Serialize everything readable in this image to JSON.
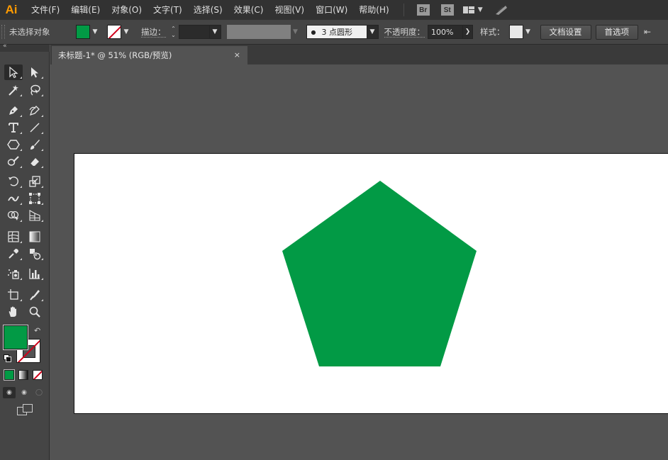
{
  "app": {
    "logo": "Ai"
  },
  "menu": [
    "文件(F)",
    "编辑(E)",
    "对象(O)",
    "文字(T)",
    "选择(S)",
    "效果(C)",
    "视图(V)",
    "窗口(W)",
    "帮助(H)"
  ],
  "bridge_badges": {
    "br": "Br",
    "st": "St"
  },
  "icons": {
    "workspace": "workspace-layout-icon",
    "dropdown": "chevron-down-icon",
    "sync": "sync-feather-icon"
  },
  "control_bar": {
    "selection_status": "未选择对象",
    "stroke_label": "描边：",
    "stroke_weight": "",
    "brush_definition": "3 点圆形",
    "opacity_label": "不透明度：",
    "opacity_value": "100%",
    "style_label": "样式：",
    "document_setup": "文档设置",
    "preferences": "首选项"
  },
  "document": {
    "tab_title": "未标题-1* @ 51% (RGB/预览)",
    "close_glyph": "×",
    "zoom_percent": 51,
    "color_mode": "RGB",
    "view": "预览"
  },
  "colors": {
    "fill": "#029a45",
    "stroke": "none",
    "artboard": "#ffffff",
    "pasteboard": "#535353",
    "accent_logo": "#ff9a00"
  },
  "artwork": {
    "shape": "pentagon",
    "fill_color": "#029a45"
  },
  "tools": [
    "selection-tool",
    "direct-selection-tool",
    "magic-wand-tool",
    "lasso-tool",
    "pen-tool",
    "curvature-tool",
    "type-tool",
    "line-segment-tool",
    "polygon-tool",
    "paintbrush-tool",
    "shaper-tool",
    "eraser-tool",
    "rotate-tool",
    "scale-tool",
    "width-tool",
    "free-transform-tool",
    "shape-builder-tool",
    "perspective-grid-tool",
    "mesh-tool",
    "gradient-tool",
    "eyedropper-tool",
    "blend-tool",
    "symbol-sprayer-tool",
    "column-graph-tool",
    "artboard-tool",
    "slice-tool",
    "hand-tool",
    "zoom-tool"
  ]
}
